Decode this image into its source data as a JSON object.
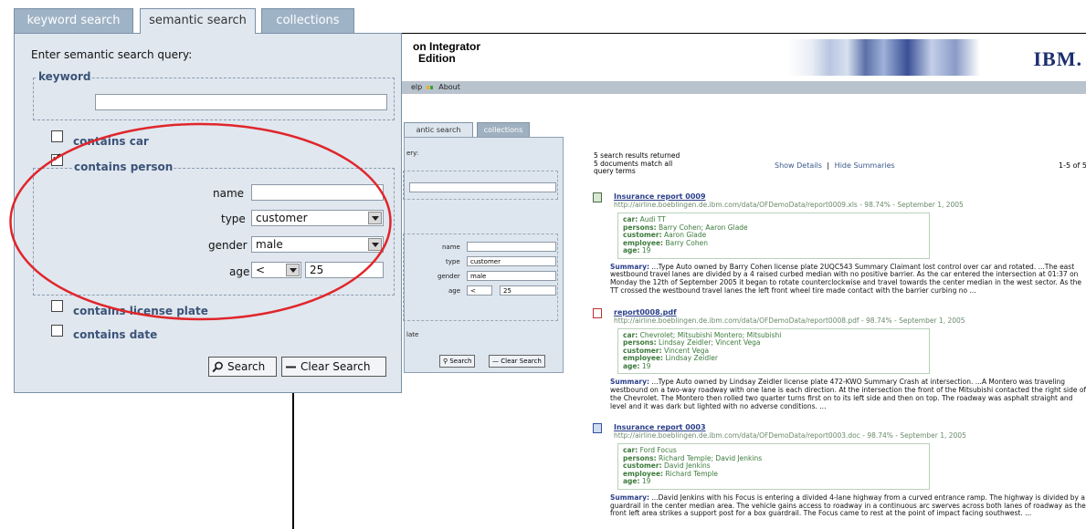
{
  "bg": {
    "title_line1": "on Integrator",
    "title_line2": "Edition",
    "brand": "IBM.",
    "menu": {
      "help": "elp",
      "about": "About"
    },
    "mini_tabs": [
      "antic search",
      "collections"
    ],
    "mini_panel": {
      "query_label": "ery:",
      "name_label": "name",
      "type_label": "type",
      "type_value": "customer",
      "gender_label": "gender",
      "gender_value": "male",
      "age_label": "age",
      "age_op": "<",
      "age_value": "25",
      "plate_label": "late",
      "search_label": "Search",
      "clear_label": "Clear Search"
    },
    "results_header": {
      "line1": "5 search results returned",
      "line2": "5 documents match all",
      "line3": "query terms",
      "show_details": "Show Details",
      "separator": "|",
      "hide_summaries": "Hide Summaries",
      "range": "1-5 of 5"
    },
    "results": [
      {
        "icon": "spreadsheet-icon",
        "title": "Insurance report 0009",
        "url": "http://airline.boeblingen.de.ibm.com/data/OFDemoData/report0009.xls - 98.74% - September 1, 2005",
        "car": "Audi TT",
        "persons": "Barry Cohen; Aaron Glade",
        "customer": "Aaron Glade",
        "employee": "Barry Cohen",
        "age": "19",
        "summary": "...Type Auto owned by Barry Cohen license plate 2UQC543 Summary Claimant lost control over car and rotated. ...The east westbound travel lanes are divided by a 4 raised curbed median with no positive barrier. As the car entered the intersection at 01:37 on Monday the 12th of September 2005 it began to rotate counterclockwise and travel towards the center median in the west sector. As the TT crossed the westbound travel lanes the left front wheel tire made contact with the barrier curbing no ..."
      },
      {
        "icon": "pdf-icon",
        "title": "report0008.pdf",
        "url": "http://airline.boeblingen.de.ibm.com/data/OFDemoData/report0008.pdf - 98.74% - September 1, 2005",
        "car": "Chevrolet; Mitsubishi Montero; Mitsubishi",
        "persons": "Lindsay Zeidler; Vincent Vega",
        "customer": "Vincent Vega",
        "employee": "Lindsay Zeidler",
        "age": "19",
        "summary": "...Type Auto owned by Lindsay Zeidler license plate 472-KWO Summary Crash at intersection. ...A Montero was traveling westbound on a two-way roadway with one lane is each direction. At the intersection the front of the Mitsubishi contacted the right side of the Chevrolet. The Montero then rolled two quarter turns first on to its left side and then on top. The roadway was asphalt straight and level and it was dark but lighted with no adverse conditions. ..."
      },
      {
        "icon": "doc-icon",
        "title": "Insurance report 0003",
        "url": "http://airline.boeblingen.de.ibm.com/data/OFDemoData/report0003.doc - 98.74% - September 1, 2005",
        "car": "Ford Focus",
        "persons": "Richard Temple; David Jenkins",
        "customer": "David Jenkins",
        "employee": "Richard Temple",
        "age": "19",
        "summary": "...David Jenkins with his Focus is entering a divided 4-lane highway from a curved entrance ramp. The highway is divided by a guardrail in the center median area. The vehicle gains access to roadway in a continuous arc swerves across both lanes of roadway as the front left area strikes a support post for a box guardrail. The Focus came to rest at the point of impact facing southwest. ..."
      }
    ],
    "labels": {
      "car": "car:",
      "persons": "persons:",
      "customer": "customer:",
      "employee": "employee:",
      "age": "age:",
      "summary": "Summary:"
    }
  },
  "fg": {
    "tabs": [
      "keyword search",
      "semantic search",
      "collections"
    ],
    "prompt": "Enter semantic search query:",
    "keyword_legend": "keyword",
    "contains_car": "contains car",
    "contains_person": "contains person",
    "name_label": "name",
    "type_label": "type",
    "type_value": "customer",
    "gender_label": "gender",
    "gender_value": "male",
    "age_label": "age",
    "age_op": "<",
    "age_value": "25",
    "contains_plate": "contains license plate",
    "contains_date": "contains date",
    "search_label": "Search",
    "clear_label": "Clear Search"
  },
  "colors": {
    "highlight": "#e0262b",
    "panel": "#e0e7ef",
    "tab": "#9fb3c6",
    "link": "#2a3f8a",
    "facet": "#3c7a3c"
  }
}
